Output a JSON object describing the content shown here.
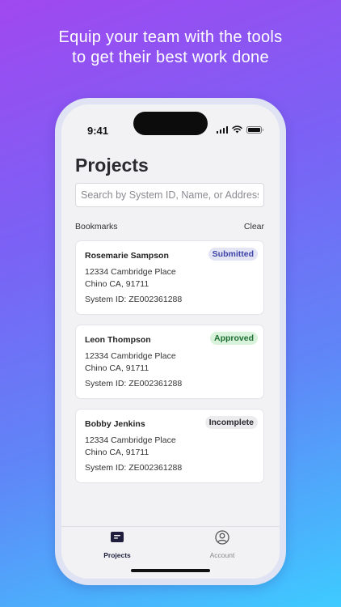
{
  "marketing": {
    "headline_line1": "Equip your team with the tools",
    "headline_line2": "to get their best work done"
  },
  "status_bar": {
    "time": "9:41"
  },
  "page": {
    "title": "Projects",
    "search_placeholder": "Search by System ID, Name, or Address"
  },
  "bookmarks": {
    "label": "Bookmarks",
    "clear_label": "Clear"
  },
  "projects": [
    {
      "name": "Rosemarie Sampson",
      "status": "Submitted",
      "status_bg": "#e3e4f4",
      "status_color": "#3d43a8",
      "address_line1": "12334 Cambridge Place",
      "address_line2": "Chino CA, 91711",
      "system_id": "System ID: ZE002361288"
    },
    {
      "name": "Leon Thompson",
      "status": "Approved",
      "status_bg": "#d8f2dc",
      "status_color": "#1f6f33",
      "address_line1": "12334 Cambridge Place",
      "address_line2": "Chino CA, 91711",
      "system_id": "System ID: ZE002361288"
    },
    {
      "name": "Bobby Jenkins",
      "status": "Incomplete",
      "status_bg": "#ececee",
      "status_color": "#2b2b2f",
      "address_line1": "12334 Cambridge Place",
      "address_line2": "Chino CA, 91711",
      "system_id": "System ID: ZE002361288"
    }
  ],
  "tab_bar": {
    "projects_label": "Projects",
    "projects_icon": "projects-icon",
    "account_label": "Account",
    "account_icon": "account-icon",
    "active_color": "#1f1f3d",
    "inactive_color": "#888888"
  }
}
